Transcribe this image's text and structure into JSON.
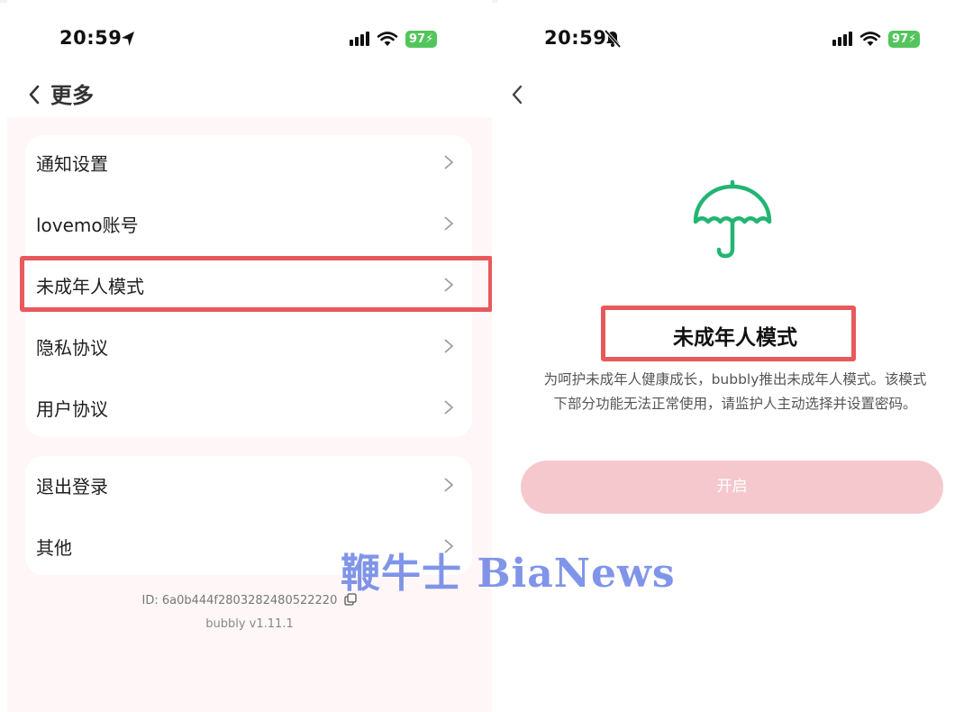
{
  "left_screen": {
    "status_bar": {
      "time": "20:59",
      "battery": "97"
    },
    "nav": {
      "title": "更多"
    },
    "menu_group_1": [
      {
        "label": "通知设置"
      },
      {
        "label": "lovemo账号"
      },
      {
        "label": "未成年人模式"
      },
      {
        "label": "隐私协议"
      },
      {
        "label": "用户协议"
      }
    ],
    "menu_group_2": [
      {
        "label": "退出登录"
      },
      {
        "label": "其他"
      }
    ],
    "footer": {
      "id_text": "ID: 6a0b444f2803282480522220",
      "version": "bubbly v1.11.1"
    }
  },
  "right_screen": {
    "status_bar": {
      "time": "20:59",
      "battery": "97"
    },
    "feature": {
      "icon": "umbrella-icon",
      "title": "未成年人模式",
      "description_line1": "为呵护未成年人健康成长，bubbly推出未成年人模式。该模式",
      "description_line2": "下部分功能无法正常使用，请监护人主动选择并设置密码。"
    },
    "enable_button": {
      "label": "开启"
    }
  },
  "watermark": {
    "text": "鞭牛士 BiaNews"
  },
  "colors": {
    "highlight": "#e8595c",
    "umbrella": "#22b573",
    "button_bg": "#f5c8ce",
    "battery": "#53c55c",
    "left_bg": "#fff7f7",
    "watermark": "#4f6ce0"
  },
  "icons": [
    "location-arrow-icon",
    "bell-muted-icon",
    "signal-icon",
    "wifi-icon",
    "battery-icon",
    "back-chevron-icon",
    "chevron-right-icon",
    "copy-icon",
    "umbrella-icon"
  ]
}
